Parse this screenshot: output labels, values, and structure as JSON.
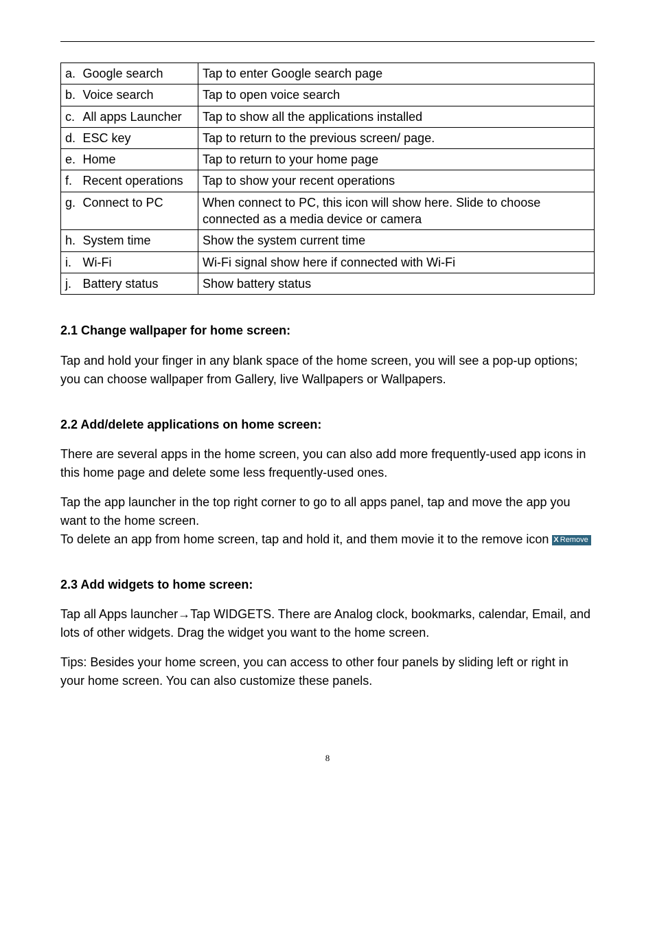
{
  "table": {
    "rows": [
      {
        "letter": "a.",
        "name": "Google search",
        "desc": "Tap to enter Google search page"
      },
      {
        "letter": "b.",
        "name": "Voice search",
        "desc": "Tap to open voice search"
      },
      {
        "letter": "c.",
        "name": "All apps Launcher",
        "desc": "Tap to show all the applications installed"
      },
      {
        "letter": "d.",
        "name": "ESC key",
        "desc": "Tap to return to the previous screen/ page."
      },
      {
        "letter": "e.",
        "name": "Home",
        "desc": "Tap to return to your home page"
      },
      {
        "letter": "f.",
        "name": "Recent operations",
        "desc": "Tap to show your recent operations"
      },
      {
        "letter": "g.",
        "name": "Connect to PC",
        "desc": "When connect to PC, this icon will show here. Slide to choose connected as a media device or camera"
      },
      {
        "letter": "h.",
        "name": "System time",
        "desc": "Show the system current time"
      },
      {
        "letter": "i.",
        "name": "Wi-Fi",
        "desc": "Wi-Fi signal show here if connected with Wi-Fi"
      },
      {
        "letter": "j.",
        "name": "Battery status",
        "desc": "Show battery status"
      }
    ]
  },
  "sections": {
    "s21_title": "2.1 Change wallpaper for home screen:",
    "s21_body": "Tap and hold your finger in any blank space of the home screen, you will see a pop-up options; you can choose wallpaper from Gallery, live Wallpapers or Wallpapers.",
    "s22_title": "2.2 Add/delete applications on home screen:",
    "s22_p1": "There are several apps in the home screen, you can also add more frequently-used app icons in this home page and delete some less frequently-used ones.",
    "s22_p2": "Tap the app launcher in the top right corner to go to all apps panel, tap and move the app you want to the home screen.",
    "s22_p3a": "To delete an app from home screen, tap and hold it, and them movie it to the remove icon ",
    "remove_btn_x": "X",
    "remove_btn_label": "Remove",
    "s23_title": "2.3 Add widgets to home screen:",
    "s23_p1": "Tap all Apps launcher→Tap WIDGETS. There are Analog clock, bookmarks, calendar, Email, and lots of other widgets. Drag the widget you want to the home screen.",
    "s23_p2": "Tips: Besides your home screen, you can access to other four panels by sliding left or right in your home screen. You can also customize these panels."
  },
  "page_number": "8"
}
